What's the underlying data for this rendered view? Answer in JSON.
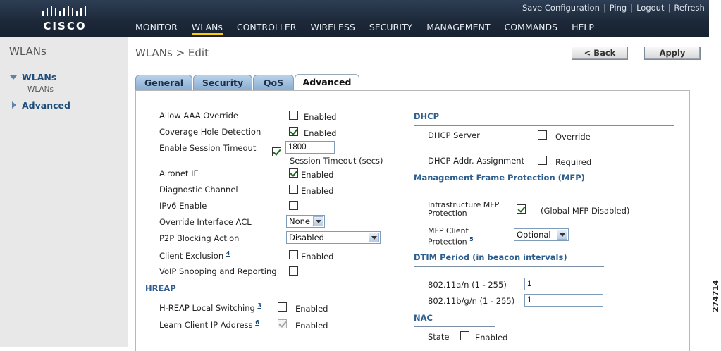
{
  "header": {
    "logo_text": "CISCO",
    "top_links": [
      "Save Configuration",
      "Ping",
      "Logout",
      "Refresh"
    ],
    "nav": [
      "MONITOR",
      "WLANs",
      "CONTROLLER",
      "WIRELESS",
      "SECURITY",
      "MANAGEMENT",
      "COMMANDS",
      "HELP"
    ],
    "active_nav": "WLANs"
  },
  "sidebar": {
    "title": "WLANs",
    "items": [
      {
        "label": "WLANs",
        "expanded": true,
        "children": [
          "WLANs"
        ]
      },
      {
        "label": "Advanced",
        "expanded": false
      }
    ]
  },
  "page": {
    "title": "WLANs > Edit",
    "back_label": "< Back",
    "apply_label": "Apply"
  },
  "tabs": [
    "General",
    "Security",
    "QoS",
    "Advanced"
  ],
  "active_tab": "Advanced",
  "left": {
    "allow_aaa_override": {
      "label": "Allow AAA Override",
      "cb_label": "Enabled",
      "checked": false
    },
    "coverage_hole": {
      "label": "Coverage Hole Detection",
      "cb_label": "Enabled",
      "checked": true
    },
    "session_timeout": {
      "label": "Enable Session Timeout",
      "checked": true,
      "value": "1800",
      "unit": "Session Timeout (secs)"
    },
    "aironet_ie": {
      "label": "Aironet IE",
      "cb_label": "Enabled",
      "checked": true
    },
    "diagnostic_channel": {
      "label": "Diagnostic Channel",
      "cb_label": "Enabled",
      "checked": false
    },
    "ipv6": {
      "label": "IPv6 Enable",
      "checked": false
    },
    "override_acl": {
      "label": "Override Interface ACL",
      "value": "None"
    },
    "p2p_blocking": {
      "label": "P2P Blocking Action",
      "value": "Disabled"
    },
    "client_exclusion": {
      "label": "Client Exclusion",
      "footnote": "4",
      "cb_label": "Enabled",
      "checked": false
    },
    "voip_snooping": {
      "label": "VoIP Snooping and Reporting",
      "checked": false
    },
    "hreap": {
      "title": "HREAP",
      "local_switching": {
        "label": "H-REAP Local Switching",
        "footnote": "3",
        "cb_label": "Enabled",
        "checked": false
      },
      "learn_client_ip": {
        "label": "Learn Client IP Address",
        "footnote": "6",
        "cb_label": "Enabled",
        "checked": true,
        "disabled": true
      }
    }
  },
  "right": {
    "dhcp": {
      "title": "DHCP",
      "server": {
        "label": "DHCP Server",
        "cb_label": "Override",
        "checked": false
      },
      "addr_assignment": {
        "label": "DHCP Addr. Assignment",
        "cb_label": "Required",
        "checked": false
      }
    },
    "mfp": {
      "title": "Management Frame Protection (MFP)",
      "infra_line1": "Infrastructure MFP",
      "infra_line2": "Protection",
      "infra_checked": true,
      "infra_note": "(Global MFP Disabled)",
      "client_line1": "MFP Client",
      "client_line2": "Protection",
      "client_footnote": "5",
      "client_value": "Optional"
    },
    "dtim": {
      "title": "DTIM Period (in beacon intervals)",
      "a_label": "802.11a/n (1 - 255)",
      "a_value": "1",
      "bg_label": "802.11b/g/n (1 - 255)",
      "bg_value": "1"
    },
    "nac": {
      "title": "NAC",
      "state_label": "State",
      "cb_label": "Enabled",
      "checked": false
    }
  },
  "figure_number": "274714"
}
